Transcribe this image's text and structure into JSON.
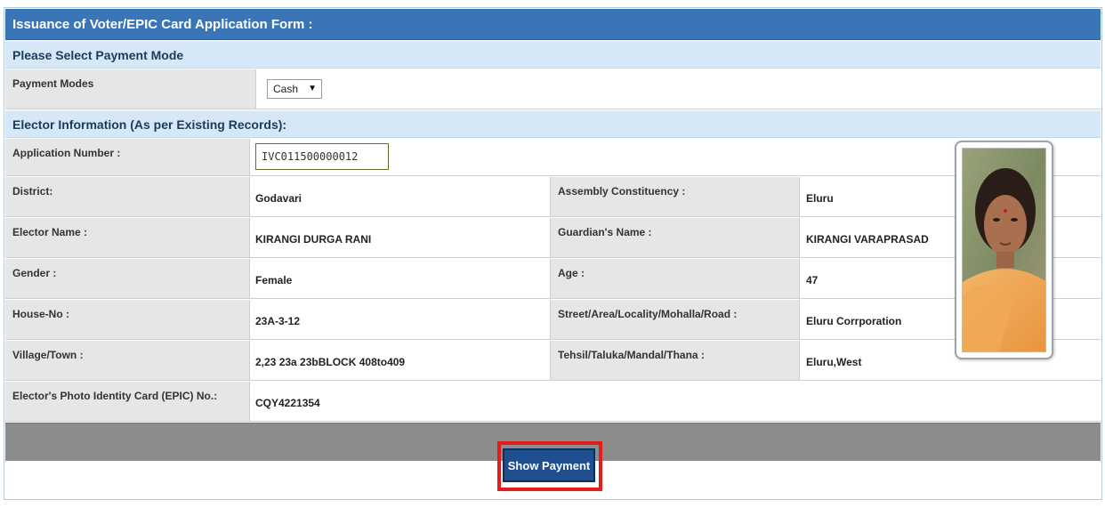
{
  "form": {
    "title": "Issuance of Voter/EPIC Card Application Form :",
    "payment_section": "Please Select Payment Mode",
    "payment_modes_label": "Payment Modes",
    "payment_mode_selected": "Cash",
    "elector_section": "Elector Information (As per Existing Records):",
    "application_number_label": "Application Number :",
    "application_number_value": "IVC011500000012",
    "show_payment_button": "Show Payment"
  },
  "elector": {
    "district_label": "District:",
    "district_value": "Godavari",
    "assembly_label": "Assembly Constituency :",
    "assembly_value": "Eluru",
    "name_label": "Elector Name :",
    "name_value": "KIRANGI DURGA RANI",
    "guardian_label": "Guardian's Name :",
    "guardian_value": "KIRANGI VARAPRASAD",
    "gender_label": "Gender :",
    "gender_value": "Female",
    "age_label": "Age :",
    "age_value": "47",
    "house_label": "House-No :",
    "house_value": "23A-3-12",
    "street_label": "Street/Area/Locality/Mohalla/Road :",
    "street_value": "Eluru Corrporation",
    "village_label": "Village/Town :",
    "village_value": "2,23 23a 23bBLOCK 408to409",
    "tehsil_label": "Tehsil/Taluka/Mandal/Thana :",
    "tehsil_value": "Eluru,West",
    "epic_label": "Elector's Photo Identity Card (EPIC) No.:",
    "epic_value": "CQY4221354"
  },
  "colors": {
    "title_bar": "#3a76b7",
    "section_bar": "#d6e8f8",
    "label_cell": "#e6e6e6",
    "footer_bar": "#8c8c8c",
    "button": "#1f4f8e",
    "highlight": "#e31c1c"
  }
}
